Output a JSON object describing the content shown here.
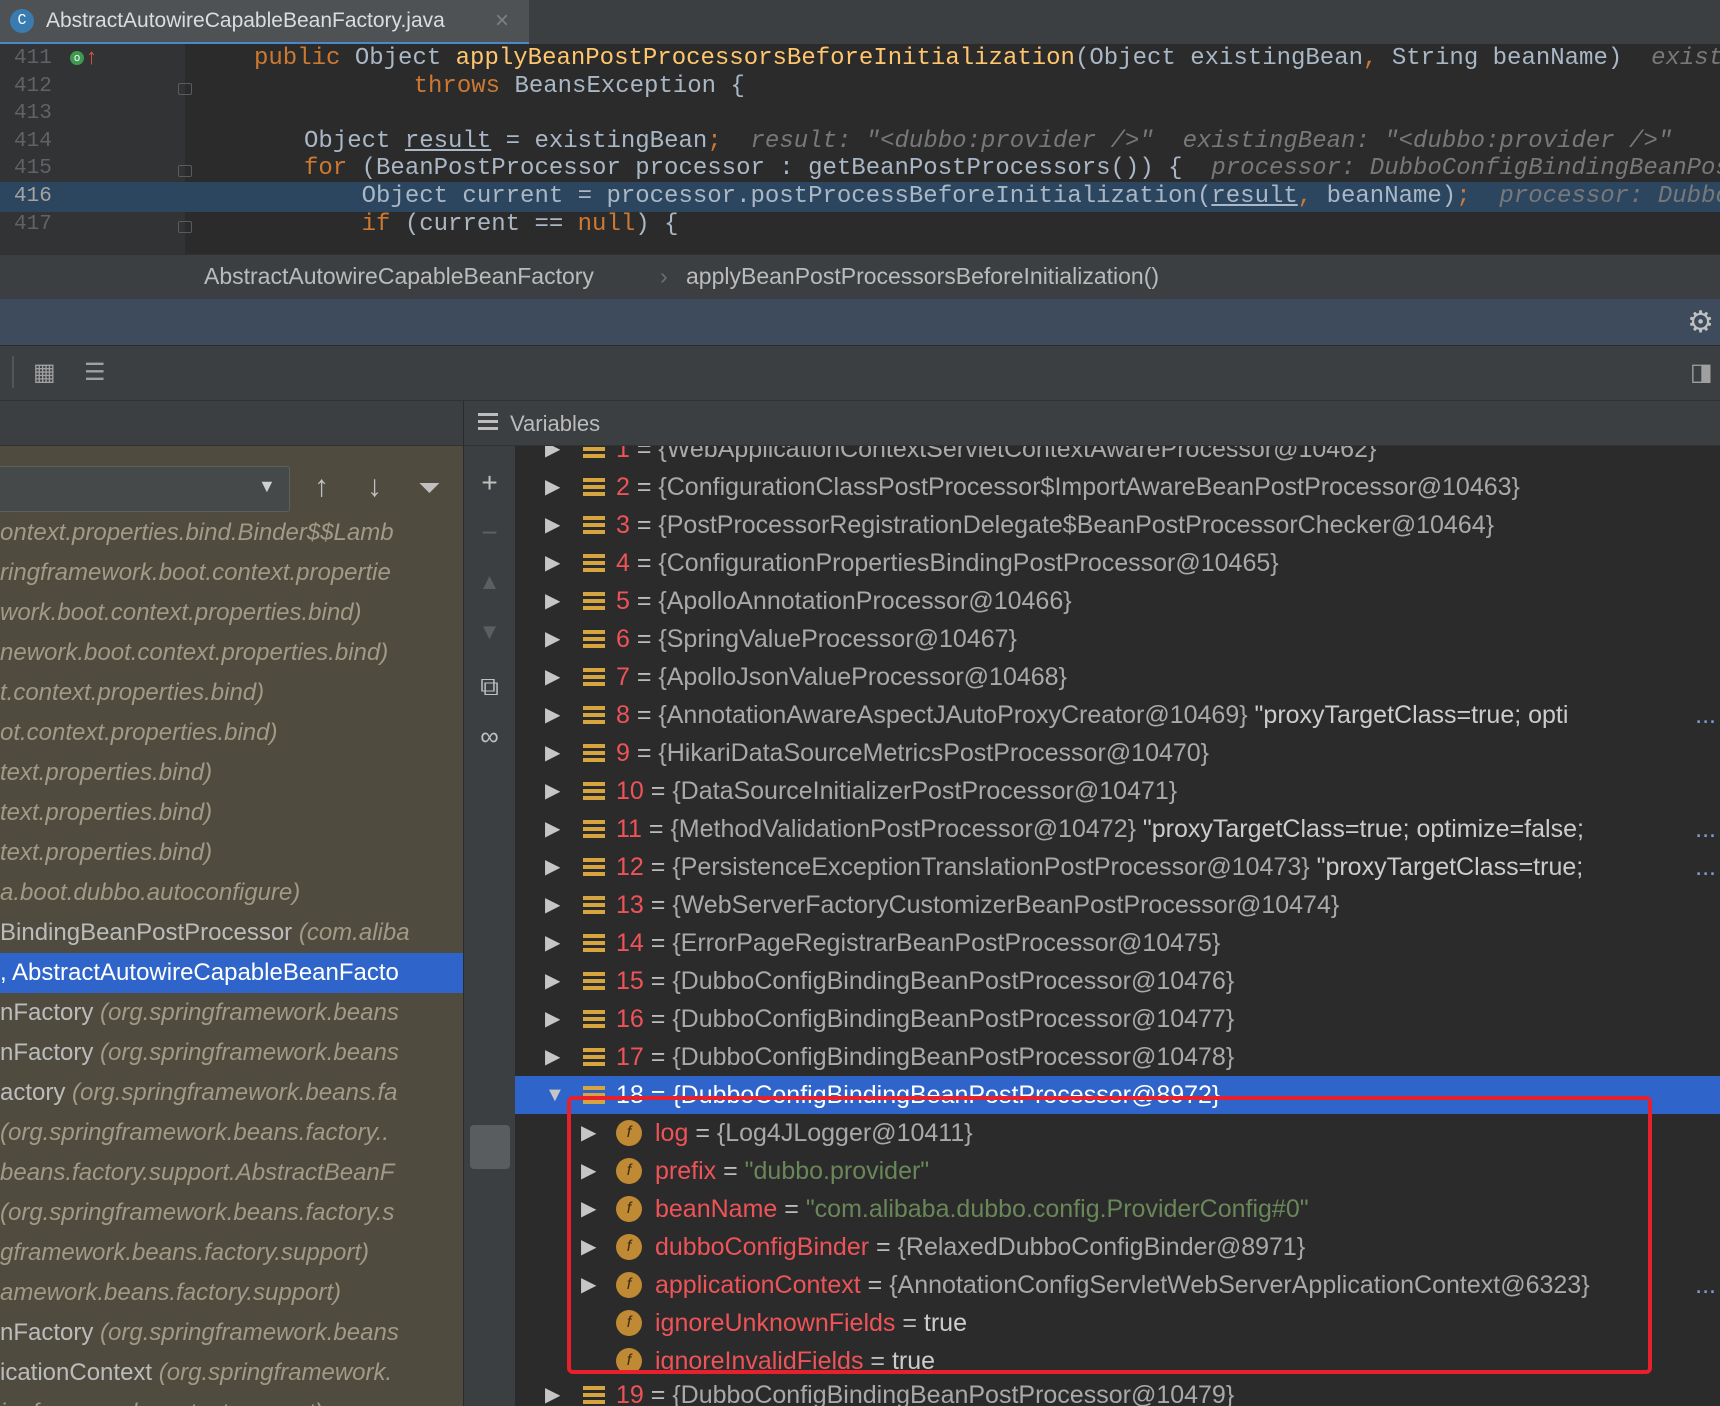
{
  "tab": {
    "icon": "C",
    "label": "AbstractAutowireCapableBeanFactory.java",
    "close": "×"
  },
  "editor": {
    "lines": [
      {
        "num": "411",
        "code": [
          {
            "c": "kw",
            "t": "public "
          },
          {
            "c": "",
            "t": "Object "
          },
          {
            "c": "fn",
            "t": "applyBeanPostProcessorsBeforeInitialization"
          },
          {
            "c": "",
            "t": "(Object existingBean"
          },
          {
            "c": "kw",
            "t": ","
          },
          {
            "c": "",
            "t": " String beanName)  "
          },
          {
            "c": "hint",
            "t": "existing"
          }
        ]
      },
      {
        "num": "412",
        "code": [
          {
            "c": "",
            "t": "    "
          },
          {
            "c": "kw",
            "t": "throws "
          },
          {
            "c": "",
            "t": "BeansException {"
          }
        ]
      },
      {
        "num": "413",
        "code": []
      },
      {
        "num": "414",
        "code": [
          {
            "c": "",
            "t": "Object "
          },
          {
            "c": "ul",
            "t": "result"
          },
          {
            "c": "",
            "t": " = existingBean"
          },
          {
            "c": "kw",
            "t": ";"
          },
          {
            "c": "hint",
            "t": "  result: \"<dubbo:provider />\"  existingBean: \"<dubbo:provider />\""
          }
        ]
      },
      {
        "num": "415",
        "code": [
          {
            "c": "kw",
            "t": "for "
          },
          {
            "c": "",
            "t": "(BeanPostProcessor processor : getBeanPostProcessors()) {  "
          },
          {
            "c": "hint",
            "t": "processor: DubboConfigBindingBeanPostP"
          }
        ]
      },
      {
        "num": "416",
        "code": [
          {
            "c": "",
            "t": "    Object current = processor.postProcessBeforeInitialization("
          },
          {
            "c": "ul",
            "t": "result"
          },
          {
            "c": "kw",
            "t": ","
          },
          {
            "c": "",
            "t": " beanName)"
          },
          {
            "c": "kw",
            "t": ";"
          },
          {
            "c": "hint",
            "t": "  processor: DubboCo"
          }
        ]
      },
      {
        "num": "417",
        "code": [
          {
            "c": "",
            "t": "    "
          },
          {
            "c": "kw",
            "t": "if "
          },
          {
            "c": "",
            "t": "(current == "
          },
          {
            "c": "kw",
            "t": "null"
          },
          {
            "c": "",
            "t": ") {"
          }
        ]
      }
    ]
  },
  "breadcrumb": {
    "class_name": "AbstractAutowireCapableBeanFactory",
    "separator": "›",
    "method": "applyBeanPostProcessorsBeforeInitialization()"
  },
  "variables": {
    "title": "Variables"
  },
  "frames": [
    {
      "m": "",
      "p": "ontext.properties.bind.Binder$$Lamb"
    },
    {
      "m": "",
      "p": "ringframework.boot.context.propertie"
    },
    {
      "m": "",
      "p": "work.boot.context.properties.bind)"
    },
    {
      "m": "",
      "p": "nework.boot.context.properties.bind)"
    },
    {
      "m": "",
      "p": "t.context.properties.bind)"
    },
    {
      "m": "",
      "p": "ot.context.properties.bind)"
    },
    {
      "m": "",
      "p": "text.properties.bind)"
    },
    {
      "m": "",
      "p": "text.properties.bind)"
    },
    {
      "m": "",
      "p": "text.properties.bind)"
    },
    {
      "m": "",
      "p": "a.boot.dubbo.autoconfigure)"
    },
    {
      "m": "BindingBeanPostProcessor ",
      "p": "(com.aliba"
    },
    {
      "m": ", AbstractAutowireCapableBeanFacto",
      "p": "",
      "sel": true
    },
    {
      "m": "nFactory ",
      "p": "(org.springframework.beans"
    },
    {
      "m": "nFactory ",
      "p": "(org.springframework.beans"
    },
    {
      "m": "actory ",
      "p": "(org.springframework.beans.fa"
    },
    {
      "m": "",
      "p": " (org.springframework.beans.factory.."
    },
    {
      "m": "",
      "p": "beans.factory.support.AbstractBeanF"
    },
    {
      "m": "",
      "p": "(org.springframework.beans.factory.s"
    },
    {
      "m": "",
      "p": "gframework.beans.factory.support)"
    },
    {
      "m": "",
      "p": "amework.beans.factory.support)"
    },
    {
      "m": "nFactory ",
      "p": "(org.springframework.beans"
    },
    {
      "m": "icationContext ",
      "p": "(org.springframework."
    },
    {
      "m": "",
      "p": "ingframework.context.support)"
    }
  ],
  "processors": [
    {
      "i": "1",
      "v": "{WebApplicationContextServletContextAwareProcessor@10462}",
      "extra": ""
    },
    {
      "i": "2",
      "v": "{ConfigurationClassPostProcessor$ImportAwareBeanPostProcessor@10463}",
      "extra": ""
    },
    {
      "i": "3",
      "v": "{PostProcessorRegistrationDelegate$BeanPostProcessorChecker@10464}",
      "extra": ""
    },
    {
      "i": "4",
      "v": "{ConfigurationPropertiesBindingPostProcessor@10465}",
      "extra": ""
    },
    {
      "i": "5",
      "v": "{ApolloAnnotationProcessor@10466}",
      "extra": ""
    },
    {
      "i": "6",
      "v": "{SpringValueProcessor@10467}",
      "extra": ""
    },
    {
      "i": "7",
      "v": "{ApolloJsonValueProcessor@10468}",
      "extra": ""
    },
    {
      "i": "8",
      "v": "{AnnotationAwareAspectJAutoProxyCreator@10469}",
      "extra": " \"proxyTargetClass=true; opti"
    },
    {
      "i": "9",
      "v": "{HikariDataSourceMetricsPostProcessor@10470}",
      "extra": ""
    },
    {
      "i": "10",
      "v": "{DataSourceInitializerPostProcessor@10471}",
      "extra": ""
    },
    {
      "i": "11",
      "v": "{MethodValidationPostProcessor@10472}",
      "extra": " \"proxyTargetClass=true; optimize=false;"
    },
    {
      "i": "12",
      "v": "{PersistenceExceptionTranslationPostProcessor@10473}",
      "extra": " \"proxyTargetClass=true;"
    },
    {
      "i": "13",
      "v": "{WebServerFactoryCustomizerBeanPostProcessor@10474}",
      "extra": ""
    },
    {
      "i": "14",
      "v": "{ErrorPageRegistrarBeanPostProcessor@10475}",
      "extra": ""
    },
    {
      "i": "15",
      "v": "{DubboConfigBindingBeanPostProcessor@10476}",
      "extra": ""
    },
    {
      "i": "16",
      "v": "{DubboConfigBindingBeanPostProcessor@10477}",
      "extra": ""
    },
    {
      "i": "17",
      "v": "{DubboConfigBindingBeanPostProcessor@10478}",
      "extra": ""
    },
    {
      "i": "18",
      "v": "{DubboConfigBindingBeanPostProcessor@8972}",
      "extra": "",
      "sel": true
    }
  ],
  "fields": [
    {
      "n": "log",
      "v": "{Log4JLogger@10411}",
      "t": "obj",
      "exp": true
    },
    {
      "n": "prefix",
      "v": "\"dubbo.provider\"",
      "t": "str",
      "exp": true
    },
    {
      "n": "beanName",
      "v": "\"com.alibaba.dubbo.config.ProviderConfig#0\"",
      "t": "str",
      "exp": true
    },
    {
      "n": "dubboConfigBinder",
      "v": "{RelaxedDubboConfigBinder@8971}",
      "t": "obj",
      "exp": true
    },
    {
      "n": "applicationContext",
      "v": "{AnnotationConfigServletWebServerApplicationContext@6323}",
      "t": "obj",
      "exp": true
    },
    {
      "n": "ignoreUnknownFields",
      "v": "true",
      "t": "plain",
      "exp": false
    },
    {
      "n": "ignoreInvalidFields",
      "v": "true",
      "t": "plain",
      "exp": false
    }
  ],
  "after": {
    "i": "19",
    "v": "{DubboConfigBindingBeanPostProcessor@10479}"
  },
  "ellipsis": "...",
  "field_icon": "f"
}
